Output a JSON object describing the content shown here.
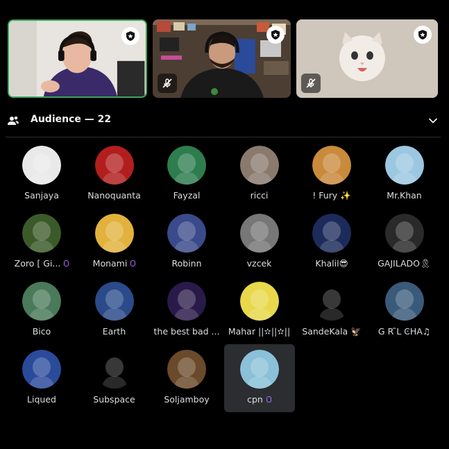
{
  "audience": {
    "title": "Audience — 22"
  },
  "icons": {
    "moderator": "shield-star-icon",
    "muted": "mic-off-icon",
    "people": "people-icon",
    "collapse": "chevron-down-icon",
    "nitro": "nitro-boost-icon"
  },
  "colors": {
    "speaking_ring": "#3ba55d",
    "selected_bg": "#2b2d31",
    "nitro": "#b072ff"
  },
  "speakers": [
    {
      "id": "speaker-1",
      "speaking": true,
      "moderator": true,
      "muted": false
    },
    {
      "id": "speaker-2",
      "speaking": false,
      "moderator": true,
      "muted": true
    },
    {
      "id": "speaker-3",
      "speaking": false,
      "moderator": true,
      "muted": true
    }
  ],
  "members": [
    {
      "name": "Sanjaya",
      "nitro": false,
      "color": "#e9e9e9"
    },
    {
      "name": "Nanoquanta",
      "nitro": false,
      "color": "#b21e1e"
    },
    {
      "name": "Fayzal",
      "nitro": false,
      "color": "#2e7d4f"
    },
    {
      "name": "ricci",
      "nitro": false,
      "color": "#8a7a6e"
    },
    {
      "name": "! Fury ✨",
      "nitro": false,
      "color": "#c98a3c"
    },
    {
      "name": "Mr.Khan",
      "nitro": false,
      "color": "#9cc7e0"
    },
    {
      "name": "Zoro [ Gi...",
      "nitro": true,
      "color": "#3b5a2a"
    },
    {
      "name": "Monami",
      "nitro": true,
      "color": "#e2b23c"
    },
    {
      "name": "Robinn",
      "nitro": false,
      "color": "#3a4a8a"
    },
    {
      "name": "vzcek",
      "nitro": false,
      "color": "#777777"
    },
    {
      "name": "Khalil😎",
      "nitro": false,
      "color": "#1c2b5a"
    },
    {
      "name": "GAJILADO🎗",
      "nitro": false,
      "color": "#2a2a2a"
    },
    {
      "name": "Bico",
      "nitro": false,
      "color": "#4a7a5a"
    },
    {
      "name": "Earth",
      "nitro": false,
      "color": "#2a4a8a"
    },
    {
      "name": "the best bad ...",
      "nitro": false,
      "color": "#2a1a4a"
    },
    {
      "name": "Mahar ||✫||✫||",
      "nitro": false,
      "color": "#e8d84a"
    },
    {
      "name": "SandeKala 🦅",
      "nitro": false,
      "color": "#000000"
    },
    {
      "name": "G R ̃L ϾHA♫",
      "nitro": false,
      "color": "#3a5a7a"
    },
    {
      "name": "Liqued",
      "nitro": false,
      "color": "#2a4a9a"
    },
    {
      "name": "Subspace",
      "nitro": false,
      "color": "#000000"
    },
    {
      "name": "Soljamboy",
      "nitro": false,
      "color": "#6a4a2a"
    },
    {
      "name": "cpn",
      "nitro": true,
      "color": "#8ac0d8",
      "selected": true
    }
  ]
}
